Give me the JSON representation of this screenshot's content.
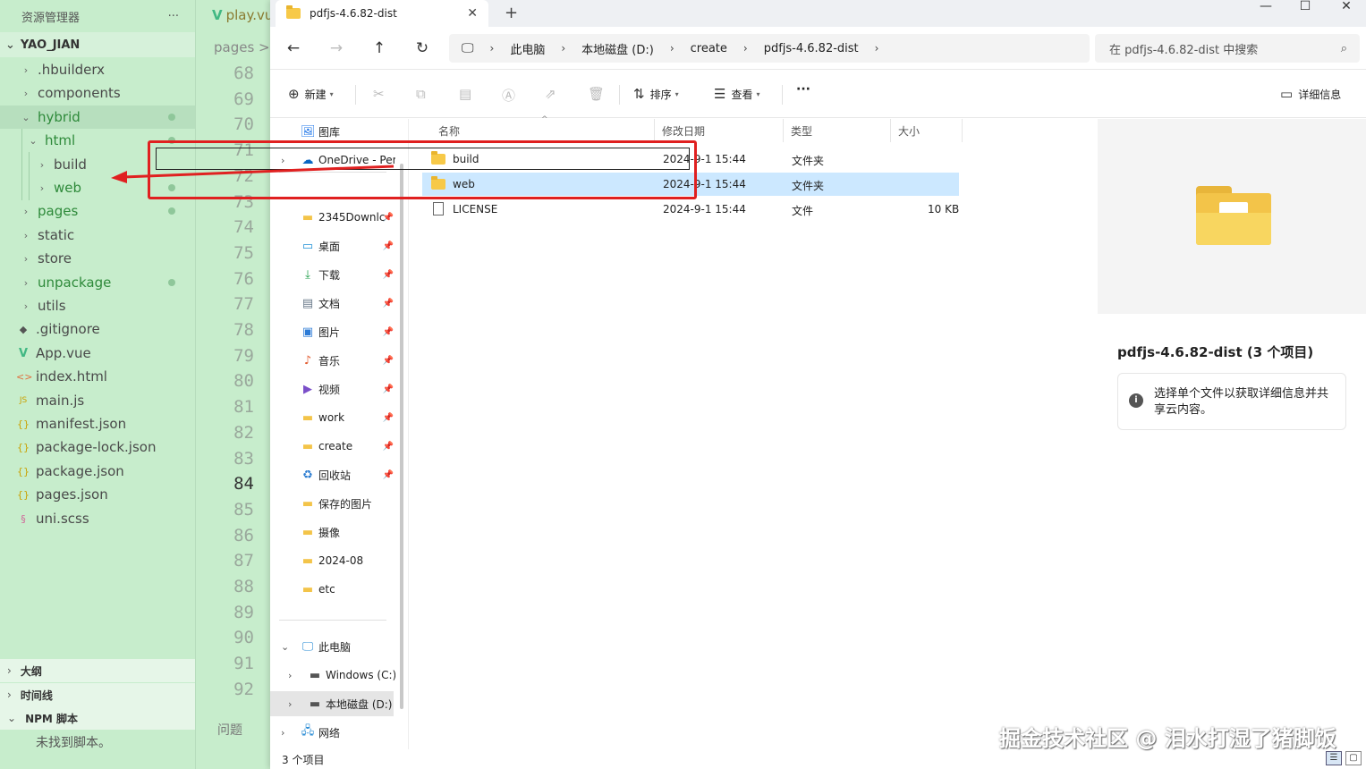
{
  "ide": {
    "sidebar_title": "资源管理器",
    "more_label": "···",
    "project": "YAO_JIAN",
    "tree": [
      {
        "label": ".hbuilderx",
        "type": "folder"
      },
      {
        "label": "components",
        "type": "folder"
      },
      {
        "label": "hybrid",
        "type": "folder-open"
      },
      {
        "label": "html",
        "type": "folder-open"
      },
      {
        "label": "build",
        "type": "folder"
      },
      {
        "label": "web",
        "type": "folder"
      },
      {
        "label": "pages",
        "type": "folder"
      },
      {
        "label": "static",
        "type": "folder"
      },
      {
        "label": "store",
        "type": "folder"
      },
      {
        "label": "unpackage",
        "type": "folder"
      },
      {
        "label": "utils",
        "type": "folder"
      },
      {
        "label": ".gitignore",
        "type": "git-file"
      },
      {
        "label": "App.vue",
        "type": "vue-file"
      },
      {
        "label": "index.html",
        "type": "html-file"
      },
      {
        "label": "main.js",
        "type": "js-file"
      },
      {
        "label": "manifest.json",
        "type": "json-file"
      },
      {
        "label": "package-lock.json",
        "type": "json-file"
      },
      {
        "label": "package.json",
        "type": "json-file"
      },
      {
        "label": "pages.json",
        "type": "json-file"
      },
      {
        "label": "uni.scss",
        "type": "scss-file"
      }
    ],
    "bottom_sections": [
      "大纲",
      "时间线",
      "NPM 脚本"
    ],
    "no_script_msg": "未找到脚本。",
    "editor_tab": "play.vu",
    "editor_breadcrumb": "pages >",
    "line_numbers": [
      "68",
      "69",
      "70",
      "71",
      "72",
      "73",
      "74",
      "75",
      "76",
      "77",
      "78",
      "79",
      "80",
      "81",
      "82",
      "83",
      "84",
      "85",
      "86",
      "87",
      "88",
      "89",
      "90",
      "91",
      "92"
    ],
    "problems_label": "问题"
  },
  "explorer": {
    "tab_title": "pdfjs-4.6.82-dist",
    "breadcrumb": [
      "此电脑",
      "本地磁盘 (D:)",
      "create",
      "pdfjs-4.6.82-dist"
    ],
    "search_placeholder": "在 pdfjs-4.6.82-dist 中搜索",
    "toolbar": {
      "new_label": "新建",
      "sort_label": "排序",
      "view_label": "查看",
      "more_label": "···",
      "details_label": "详细信息"
    },
    "nav_items": [
      {
        "label": "图库",
        "icon": "gallery-icon",
        "pinned": false
      },
      {
        "label": "OneDrive - Per",
        "icon": "onedrive-icon",
        "pinned": false
      },
      {
        "label": "2345Downlc",
        "icon": "folder-icon",
        "pinned": true
      },
      {
        "label": "桌面",
        "icon": "desktop-icon",
        "pinned": true
      },
      {
        "label": "下载",
        "icon": "download-icon",
        "pinned": true
      },
      {
        "label": "文档",
        "icon": "document-icon",
        "pinned": true
      },
      {
        "label": "图片",
        "icon": "pictures-icon",
        "pinned": true
      },
      {
        "label": "音乐",
        "icon": "music-icon",
        "pinned": true
      },
      {
        "label": "视频",
        "icon": "video-icon",
        "pinned": true
      },
      {
        "label": "work",
        "icon": "folder-icon",
        "pinned": true
      },
      {
        "label": "create",
        "icon": "folder-icon",
        "pinned": true
      },
      {
        "label": "回收站",
        "icon": "recycle-bin-icon",
        "pinned": true
      },
      {
        "label": "保存的图片",
        "icon": "folder-icon",
        "pinned": false
      },
      {
        "label": "摄像",
        "icon": "folder-icon",
        "pinned": false
      },
      {
        "label": "2024-08",
        "icon": "folder-icon",
        "pinned": false
      },
      {
        "label": "etc",
        "icon": "folder-icon",
        "pinned": false
      },
      {
        "label": "此电脑",
        "icon": "pc-icon",
        "pinned": false
      },
      {
        "label": "Windows (C:)",
        "icon": "drive-icon",
        "pinned": false
      },
      {
        "label": "本地磁盘 (D:)",
        "icon": "drive-icon",
        "pinned": false
      },
      {
        "label": "网络",
        "icon": "network-icon",
        "pinned": false
      }
    ],
    "columns": [
      "名称",
      "修改日期",
      "类型",
      "大小"
    ],
    "files": [
      {
        "name": "build",
        "date": "2024-9-1 15:44",
        "type": "文件夹",
        "size": ""
      },
      {
        "name": "web",
        "date": "2024-9-1 15:44",
        "type": "文件夹",
        "size": ""
      },
      {
        "name": "LICENSE",
        "date": "2024-9-1 15:44",
        "type": "文件",
        "size": "10 KB"
      }
    ],
    "details_title": "pdfjs-4.6.82-dist (3 个项目)",
    "details_msg": "选择单个文件以获取详细信息并共享云内容。",
    "status_count": "3 个项目"
  },
  "watermark": "掘金技术社区 @ 泪水打湿了猪脚饭",
  "colors": {
    "ide_bg": "#c7edcc",
    "selection": "#cce8ff",
    "annotation_red": "#e02020"
  }
}
